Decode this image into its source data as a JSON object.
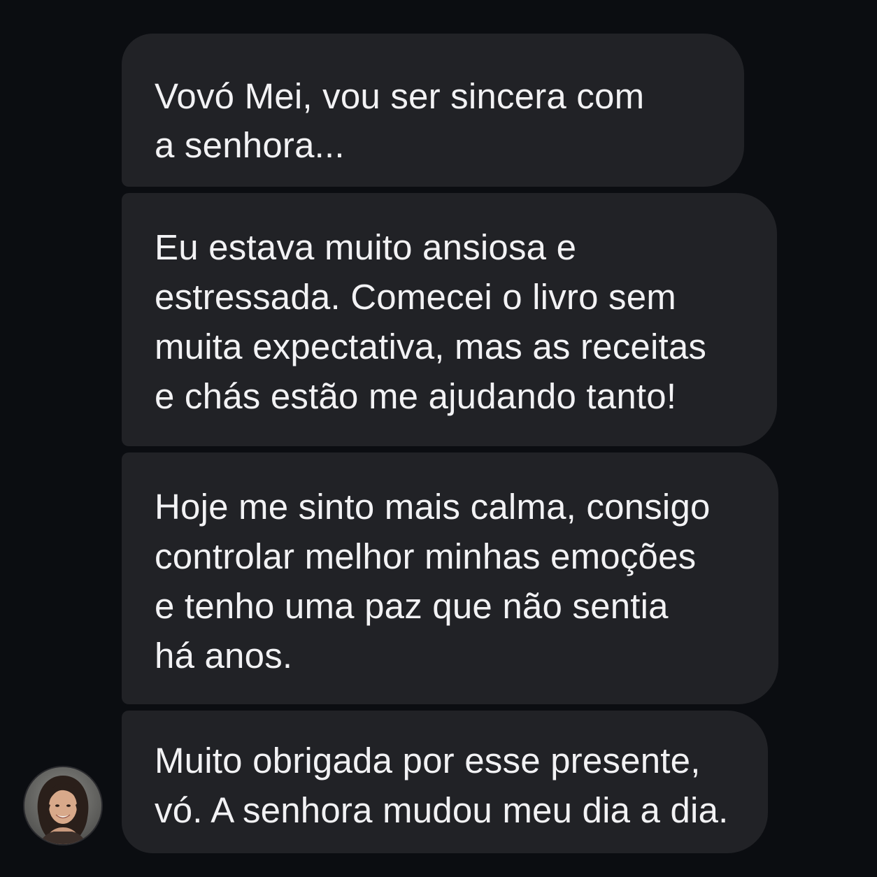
{
  "conversation": {
    "messages": [
      {
        "lines": [
          "Vovó Mei, vou ser sincera com",
          "a senhora..."
        ]
      },
      {
        "lines": [
          "Eu estava muito ansiosa e",
          "estressada. Comecei o livro sem",
          "muita expectativa, mas as receitas",
          "e chás estão me ajudando tanto!"
        ]
      },
      {
        "lines": [
          "Hoje me sinto mais calma, consigo",
          "controlar melhor minhas emoções",
          "e tenho uma paz que não sentia",
          "há anos."
        ]
      },
      {
        "lines": [
          "Muito obrigada por esse presente,",
          "vó. A senhora mudou meu dia a dia."
        ]
      }
    ],
    "sender_avatar": {
      "icon": "user-avatar-photo"
    }
  },
  "colors": {
    "background": "#0b0d11",
    "bubble": "#212226",
    "text": "#f2f2f4"
  }
}
